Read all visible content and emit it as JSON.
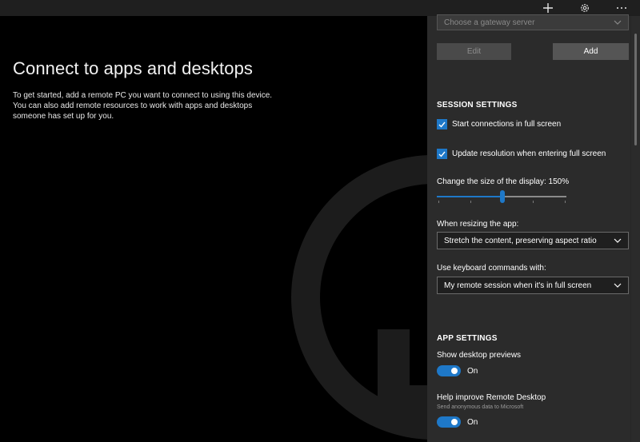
{
  "titlebar": {
    "add_icon": "plus-icon",
    "settings_icon": "gear-icon",
    "more_icon": "ellipsis-icon"
  },
  "main": {
    "title": "Connect to apps and desktops",
    "intro_line1": "To get started, add a remote PC you want to connect to using this device.",
    "intro_line2": "You can also add remote resources to work with apps and desktops someone has set up for you."
  },
  "panel": {
    "gateway_placeholder": "Choose a gateway server",
    "edit_label": "Edit",
    "add_label": "Add",
    "session_settings": {
      "heading": "SESSION SETTINGS",
      "fullscreen_label": "Start connections in full screen",
      "fullscreen_checked": true,
      "update_resolution_label": "Update resolution when entering full screen",
      "update_resolution_checked": true,
      "display_size_label": "Change the size of the display: 150%",
      "display_size_value": 150,
      "resize_label": "When resizing the app:",
      "resize_value": "Stretch the content, preserving aspect ratio",
      "keyboard_label": "Use keyboard commands with:",
      "keyboard_value": "My remote session when it's in full screen"
    },
    "app_settings": {
      "heading": "APP SETTINGS",
      "previews_label": "Show desktop previews",
      "previews_state": "On",
      "improve_label": "Help improve Remote Desktop",
      "improve_sublabel": "Send anonymous data to Microsoft",
      "improve_state": "On"
    }
  },
  "colors": {
    "accent": "#1e78c8",
    "panel_bg": "#2b2b2b",
    "main_bg": "#000000"
  }
}
